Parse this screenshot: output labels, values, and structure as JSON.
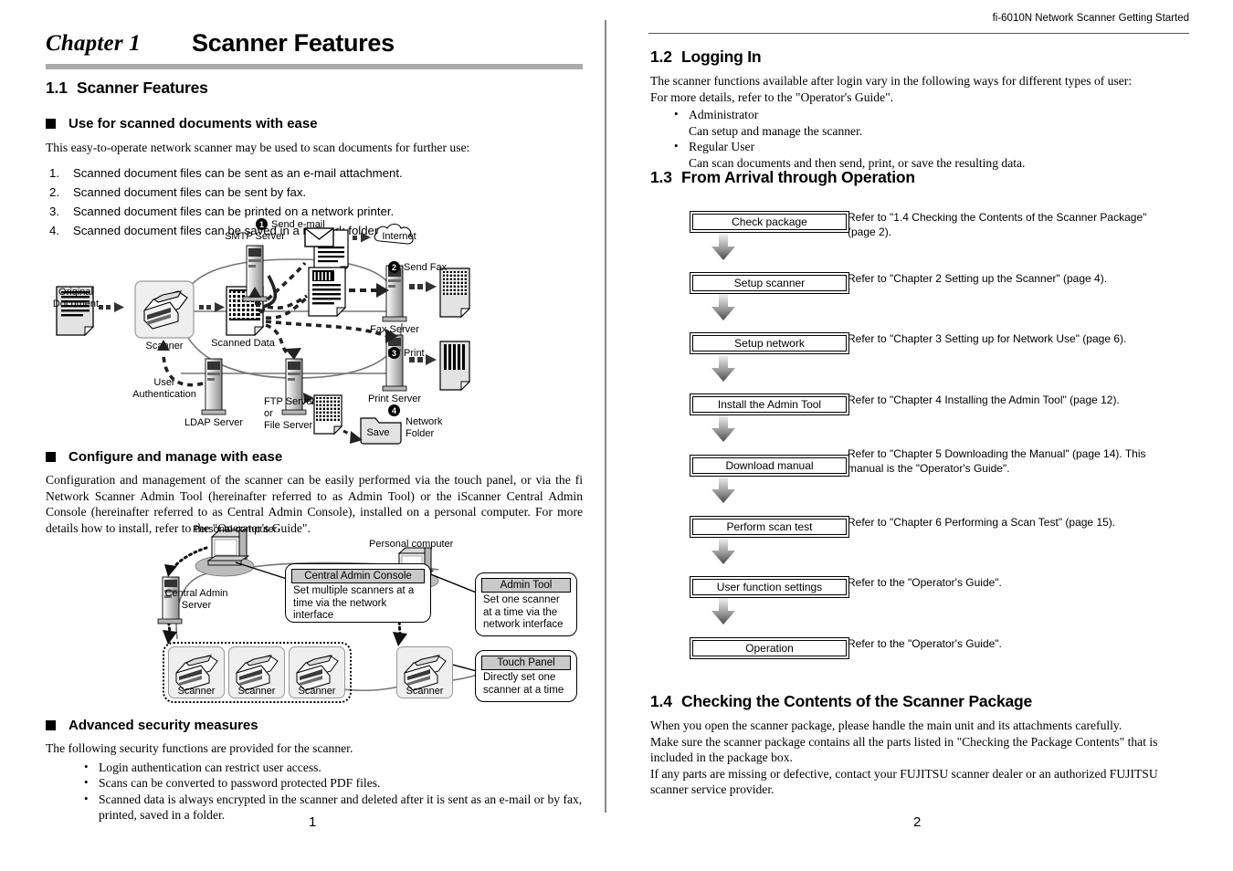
{
  "document": {
    "running_header": "fi-6010N Network Scanner Getting Started",
    "left_page_number": "1",
    "right_page_number": "2"
  },
  "chapter": {
    "label": "Chapter 1",
    "title": "Scanner Features"
  },
  "section_1_1": {
    "number": "1.1",
    "title": "Scanner Features",
    "sub_a": {
      "title": "Use for scanned documents with ease",
      "intro": "This easy-to-operate network scanner may be used to scan documents for further use:",
      "items": [
        {
          "n": "1.",
          "text": "Scanned document files can be sent as an e-mail attachment."
        },
        {
          "n": "2.",
          "text": "Scanned document files can be sent by fax."
        },
        {
          "n": "3.",
          "text": "Scanned document files can be printed on a network printer."
        },
        {
          "n": "4.",
          "text": "Scanned document files can be saved in a network folder."
        }
      ]
    },
    "sub_b": {
      "title": "Configure and manage with ease",
      "paragraph": "Configuration and management of the scanner can be easily performed via the touch panel, or via the fi Network Scanner Admin Tool (hereinafter referred to as Admin Tool) or the iScanner Central Admin Console (hereinafter referred to as Central Admin Console), installed on a personal computer. For more details how to install, refer to the \"Operator's Guide\"."
    },
    "sub_c": {
      "title": "Advanced security measures",
      "intro": "The following security functions are provided for the scanner.",
      "bullets": [
        "Login authentication can restrict user access.",
        "Scans can be converted to password protected PDF files.",
        "Scanned data is always encrypted in the scanner and deleted after it is sent as an e-mail or by fax, printed, saved in a folder."
      ]
    }
  },
  "diagram_flow": {
    "labels": {
      "original_document": "Original\nDocument",
      "scanner": "Scanner",
      "scanned_data": "Scanned Data",
      "smtp_server": "SMTP Server",
      "internet": "Internet",
      "fax_server": "Fax Server",
      "print_server": "Print Server",
      "ldap_server": "LDAP Server",
      "ftp_server": "FTP Server\nor\nFile Server",
      "user_authentication": "User\nAuthentication",
      "save": "Save",
      "network_folder": "Network\nFolder"
    },
    "steps": [
      {
        "num": "1",
        "label": "Send e-mail"
      },
      {
        "num": "2",
        "label": "Send Fax"
      },
      {
        "num": "3",
        "label": "Print"
      },
      {
        "num": "4",
        "label": "Network Folder"
      }
    ]
  },
  "diagram_admin": {
    "labels": {
      "personal_computer_left": "Personal computer",
      "personal_computer_right": "Personal computer",
      "central_admin_server": "Central Admin\nServer",
      "scanner": "Scanner"
    },
    "callouts": [
      {
        "head": "Central Admin Console",
        "body": "Set multiple scanners at a time via the network interface"
      },
      {
        "head": "Admin Tool",
        "body": "Set one scanner at a time via the network interface"
      },
      {
        "head": "Touch Panel",
        "body": "Directly set one scanner at a time"
      }
    ]
  },
  "section_1_2": {
    "number": "1.2",
    "title": "Logging In",
    "lines": [
      "The scanner functions available after login vary in the following ways for different types of user:",
      "For more details, refer to the \"Operator's Guide\"."
    ],
    "roles": [
      {
        "name": "Administrator",
        "desc": "Can setup and manage the scanner."
      },
      {
        "name": "Regular User",
        "desc": "Can scan documents and then send, print, or save the resulting data."
      }
    ]
  },
  "section_1_3": {
    "number": "1.3",
    "title": "From Arrival through Operation",
    "steps": [
      {
        "box": "Check package",
        "ref": "Refer to \"1.4 Checking the Contents of the Scanner Package\" (page 2)."
      },
      {
        "box": "Setup scanner",
        "ref": "Refer to \"Chapter 2 Setting up the Scanner\" (page 4)."
      },
      {
        "box": "Setup network",
        "ref": "Refer to \"Chapter 3 Setting up for Network Use\" (page 6)."
      },
      {
        "box": "Install the Admin Tool",
        "ref": "Refer to \"Chapter 4 Installing the Admin Tool\" (page 12)."
      },
      {
        "box": "Download manual",
        "ref": "Refer to \"Chapter 5 Downloading the Manual\" (page 14). This manual is the \"Operator's Guide\"."
      },
      {
        "box": "Perform scan test",
        "ref": "Refer to \"Chapter 6 Performing a Scan Test\" (page 15)."
      },
      {
        "box": "User function settings",
        "ref": "Refer to the \"Operator's Guide\"."
      },
      {
        "box": "Operation",
        "ref": "Refer to the \"Operator's Guide\"."
      }
    ]
  },
  "section_1_4": {
    "number": "1.4",
    "title": "Checking the Contents of the Scanner Package",
    "lines": [
      "When you open the scanner package, please handle the main unit and its attachments carefully.",
      "Make sure the scanner package contains all the parts listed in \"Checking the Package Contents\" that is included in the package box.",
      "If any parts are missing or defective, contact your FUJITSU scanner dealer or an authorized FUJITSU scanner service provider."
    ]
  },
  "colors": {
    "rule_gray": "#aaaaaa",
    "divider_gray": "#888888",
    "scanner_box_fill": "#efefef",
    "callout_head_fill": "#c9c9c9"
  }
}
